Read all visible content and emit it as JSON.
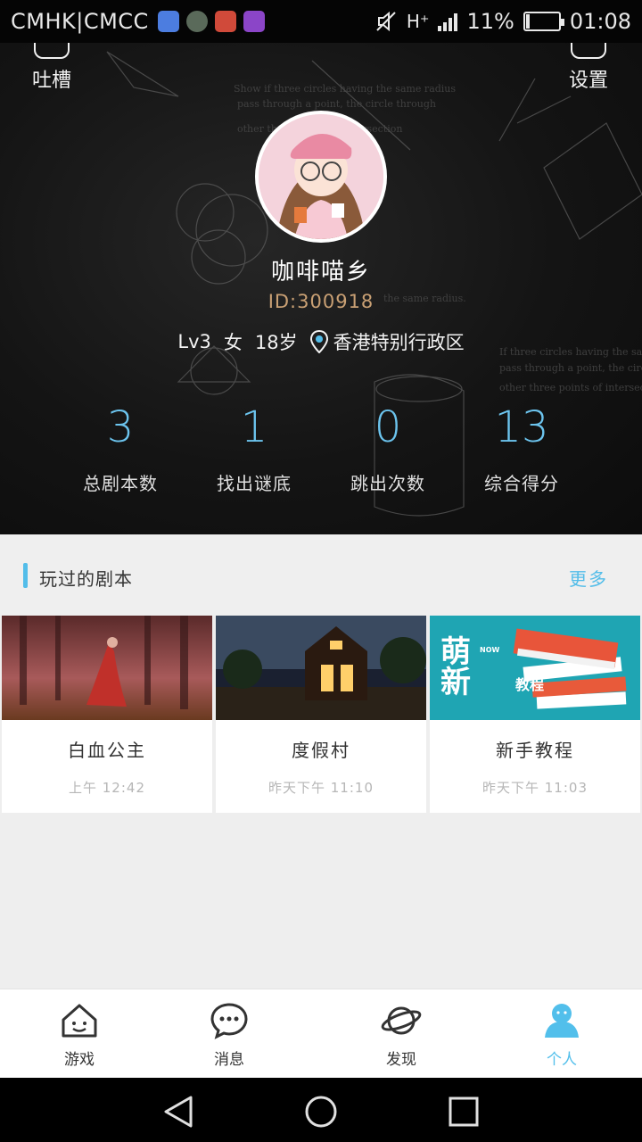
{
  "status_bar": {
    "carrier": "CMHK|CMCC",
    "network": "H⁺",
    "battery_percent": "11%",
    "battery_level": 0.11,
    "time": "01:08",
    "app_icon_colors": [
      "#4c7de0",
      "#5a6a5a",
      "#d04a3a",
      "#8b45c8"
    ]
  },
  "header": {
    "left_button": "吐槽",
    "right_button": "设置",
    "nickname": "咖啡喵乡",
    "id_text": "ID:300918",
    "level": "Lv3",
    "gender": "女",
    "age": "18岁",
    "location": "香港特别行政区",
    "stats": [
      {
        "value": "3",
        "label": "总剧本数"
      },
      {
        "value": "1",
        "label": "找出谜底"
      },
      {
        "value": "0",
        "label": "跳出次数"
      },
      {
        "value": "13",
        "label": "综合得分"
      }
    ]
  },
  "played_section": {
    "title": "玩过的剧本",
    "more": "更多",
    "cards": [
      {
        "title": "白血公主",
        "time": "上午 12:42"
      },
      {
        "title": "度假村",
        "time": "昨天下午 11:10"
      },
      {
        "title": "新手教程",
        "time": "昨天下午 11:03",
        "thumb_text_main": "萌新",
        "thumb_text_now": "NOW",
        "thumb_text_sub": "教程"
      }
    ]
  },
  "bottom_nav": [
    {
      "label": "游戏",
      "icon": "house-face-icon"
    },
    {
      "label": "消息",
      "icon": "chat-bubble-icon"
    },
    {
      "label": "发现",
      "icon": "planet-icon"
    },
    {
      "label": "个人",
      "icon": "person-icon",
      "active": true
    }
  ],
  "colors": {
    "accent": "#53bde9",
    "id_color": "#c9a074",
    "stat_number": "#6cc4ee"
  }
}
